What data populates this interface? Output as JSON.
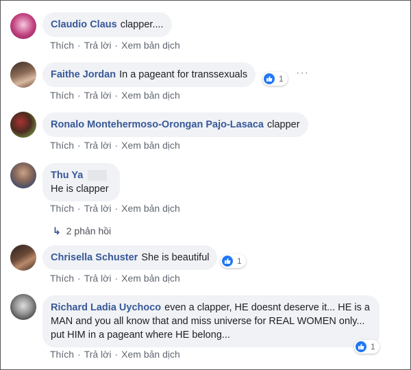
{
  "actions": {
    "like": "Thích",
    "reply": "Trả lời",
    "translate": "Xem bản dịch",
    "sep": "·"
  },
  "like_color": "#2078f4",
  "comments": [
    {
      "author": "Claudio Claus",
      "text": "clapper...."
    },
    {
      "author": "Faithe Jordan",
      "text": "In a pageant for transsexuals",
      "reactions": "1"
    },
    {
      "author": "Ronalo Montehermoso-Orongan Pajo-Lasaca",
      "text": "clapper"
    },
    {
      "author": "Thu Ya",
      "text": "He is clapper",
      "replies": "2 phản hồi"
    },
    {
      "author": "Chrisella Schuster",
      "text": "She is beautiful",
      "reactions": "1"
    },
    {
      "author": "Richard Ladia Uychoco",
      "text": "even a clapper, HE doesnt deserve it... HE is a MAN and you all know that and miss universe for REAL WOMEN only... put HIM in a pageant where HE belong...",
      "reactions": "1"
    }
  ]
}
